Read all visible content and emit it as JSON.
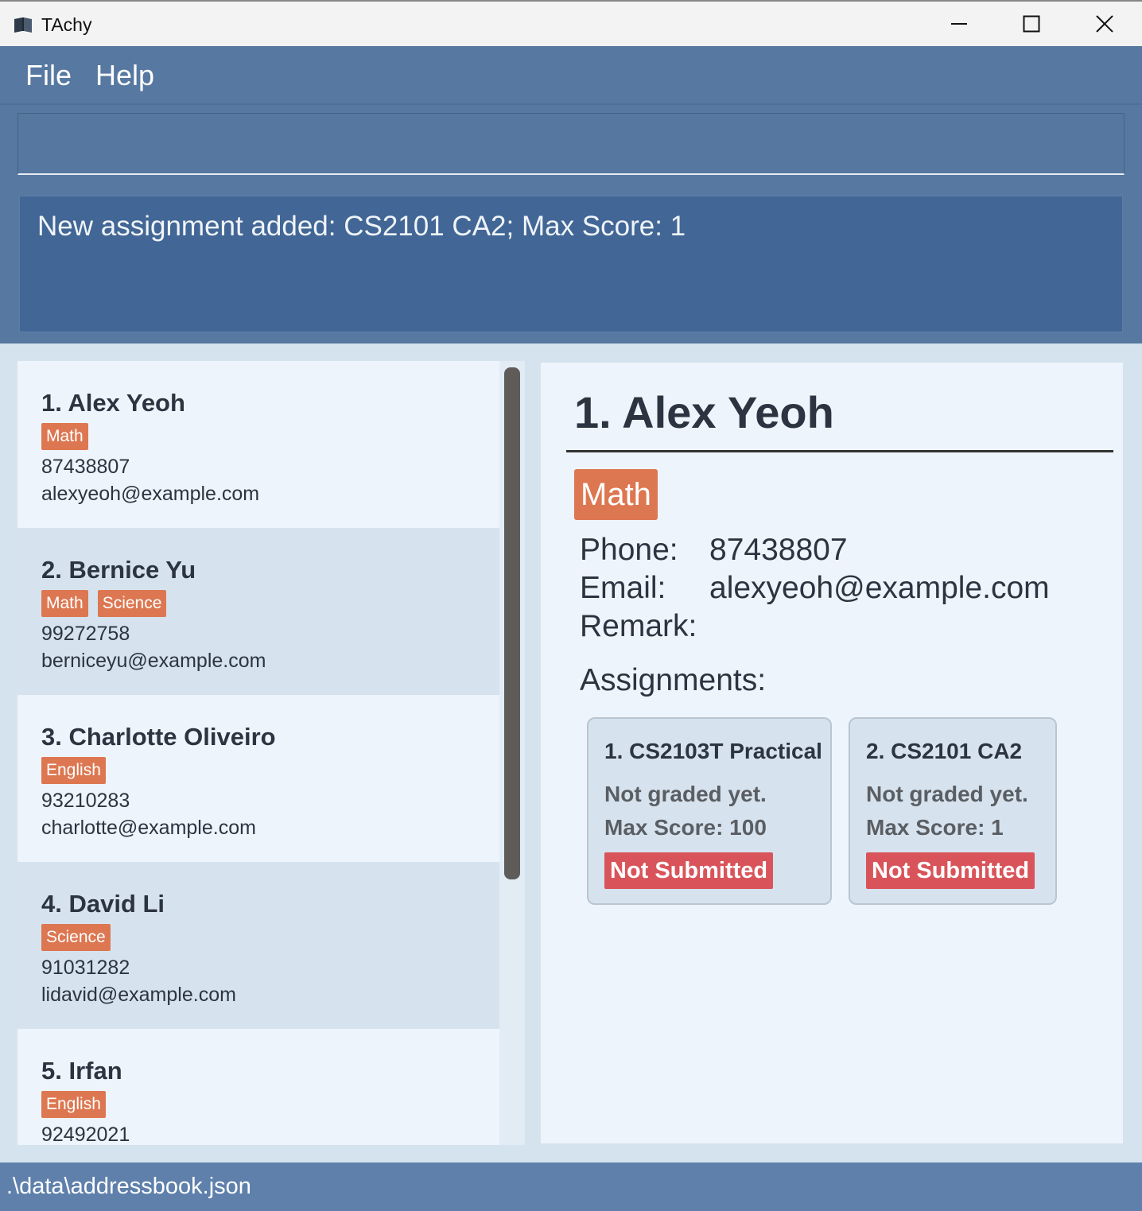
{
  "window": {
    "title": "TAchy",
    "icon": "book-icon"
  },
  "menu": {
    "file": "File",
    "help": "Help"
  },
  "command": {
    "value": "",
    "placeholder": ""
  },
  "result": {
    "message": "New assignment added: CS2101 CA2; Max Score: 1"
  },
  "persons": [
    {
      "name": "1. Alex Yeoh",
      "tags": [
        "Math"
      ],
      "phone": "87438807",
      "email": "alexyeoh@example.com"
    },
    {
      "name": "2. Bernice Yu",
      "tags": [
        "Math",
        "Science"
      ],
      "phone": "99272758",
      "email": "berniceyu@example.com"
    },
    {
      "name": "3. Charlotte Oliveiro",
      "tags": [
        "English"
      ],
      "phone": "93210283",
      "email": "charlotte@example.com"
    },
    {
      "name": "4. David Li",
      "tags": [
        "Science"
      ],
      "phone": "91031282",
      "email": "lidavid@example.com"
    },
    {
      "name": "5. Irfan",
      "tags": [
        "English"
      ],
      "phone": "92492021",
      "email": ""
    }
  ],
  "detail": {
    "name": "1. Alex Yeoh",
    "tag": "Math",
    "phone_label": "Phone:",
    "phone": "87438807",
    "email_label": "Email:",
    "email": "alexyeoh@example.com",
    "remark_label": "Remark:",
    "remark": "",
    "assignments_label": "Assignments:",
    "assignments": [
      {
        "title": "1. CS2103T Practical",
        "grade": "Not graded yet.",
        "max": "Max Score: 100",
        "status": "Not Submitted"
      },
      {
        "title": "2. CS2101 CA2",
        "grade": "Not graded yet.",
        "max": "Max Score: 1",
        "status": "Not Submitted"
      }
    ]
  },
  "status_bar": {
    "path": ".\\data\\addressbook.json"
  },
  "colors": {
    "accent": "#5778a0",
    "tag": "#dd7751",
    "not_submitted": "#d9545a"
  }
}
